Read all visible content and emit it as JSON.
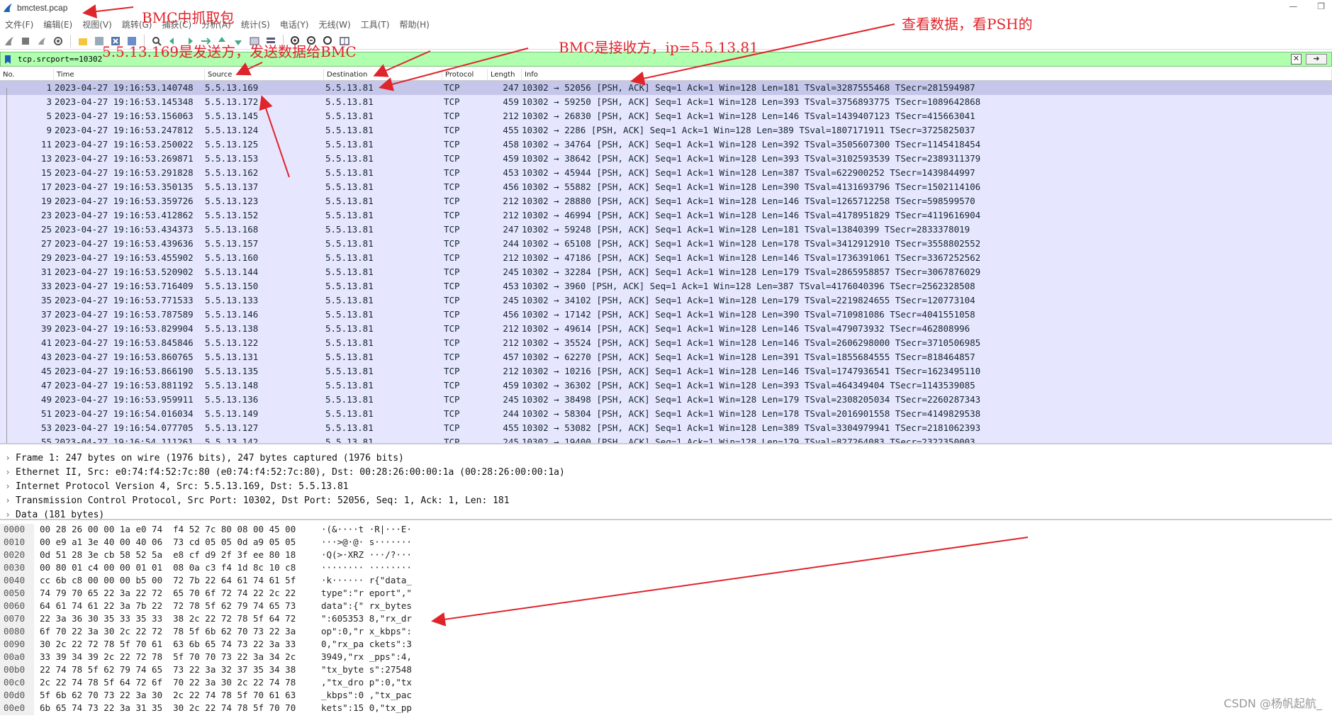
{
  "window": {
    "title": "bmctest.pcap",
    "minimize": "—",
    "restore": "❐"
  },
  "menu": [
    "文件(F)",
    "编辑(E)",
    "视图(V)",
    "跳转(G)",
    "捕获(C)",
    "分析(A)",
    "统计(S)",
    "电话(Y)",
    "无线(W)",
    "工具(T)",
    "帮助(H)"
  ],
  "filter": {
    "value": "tcp.srcport==10302",
    "clear": "✕",
    "apply": "➜"
  },
  "columns": [
    "No.",
    "Time",
    "Source",
    "Destination",
    "Protocol",
    "Length",
    "Info"
  ],
  "packets": [
    {
      "no": "1",
      "time": "2023-04-27 19:16:53.140748",
      "src": "5.5.13.169",
      "dst": "5.5.13.81",
      "proto": "TCP",
      "len": "247",
      "info": "10302 → 52056 [PSH, ACK] Seq=1 Ack=1 Win=128 Len=181 TSval=3287555468 TSecr=281594987"
    },
    {
      "no": "3",
      "time": "2023-04-27 19:16:53.145348",
      "src": "5.5.13.172",
      "dst": "5.5.13.81",
      "proto": "TCP",
      "len": "459",
      "info": "10302 → 59250 [PSH, ACK] Seq=1 Ack=1 Win=128 Len=393 TSval=3756893775 TSecr=1089642868"
    },
    {
      "no": "5",
      "time": "2023-04-27 19:16:53.156063",
      "src": "5.5.13.145",
      "dst": "5.5.13.81",
      "proto": "TCP",
      "len": "212",
      "info": "10302 → 26830 [PSH, ACK] Seq=1 Ack=1 Win=128 Len=146 TSval=1439407123 TSecr=415663041"
    },
    {
      "no": "9",
      "time": "2023-04-27 19:16:53.247812",
      "src": "5.5.13.124",
      "dst": "5.5.13.81",
      "proto": "TCP",
      "len": "455",
      "info": "10302 → 2286 [PSH, ACK] Seq=1 Ack=1 Win=128 Len=389 TSval=1807171911 TSecr=3725825037"
    },
    {
      "no": "11",
      "time": "2023-04-27 19:16:53.250022",
      "src": "5.5.13.125",
      "dst": "5.5.13.81",
      "proto": "TCP",
      "len": "458",
      "info": "10302 → 34764 [PSH, ACK] Seq=1 Ack=1 Win=128 Len=392 TSval=3505607300 TSecr=1145418454"
    },
    {
      "no": "13",
      "time": "2023-04-27 19:16:53.269871",
      "src": "5.5.13.153",
      "dst": "5.5.13.81",
      "proto": "TCP",
      "len": "459",
      "info": "10302 → 38642 [PSH, ACK] Seq=1 Ack=1 Win=128 Len=393 TSval=3102593539 TSecr=2389311379"
    },
    {
      "no": "15",
      "time": "2023-04-27 19:16:53.291828",
      "src": "5.5.13.162",
      "dst": "5.5.13.81",
      "proto": "TCP",
      "len": "453",
      "info": "10302 → 45944 [PSH, ACK] Seq=1 Ack=1 Win=128 Len=387 TSval=622900252 TSecr=1439844997"
    },
    {
      "no": "17",
      "time": "2023-04-27 19:16:53.350135",
      "src": "5.5.13.137",
      "dst": "5.5.13.81",
      "proto": "TCP",
      "len": "456",
      "info": "10302 → 55882 [PSH, ACK] Seq=1 Ack=1 Win=128 Len=390 TSval=4131693796 TSecr=1502114106"
    },
    {
      "no": "19",
      "time": "2023-04-27 19:16:53.359726",
      "src": "5.5.13.123",
      "dst": "5.5.13.81",
      "proto": "TCP",
      "len": "212",
      "info": "10302 → 28880 [PSH, ACK] Seq=1 Ack=1 Win=128 Len=146 TSval=1265712258 TSecr=598599570"
    },
    {
      "no": "23",
      "time": "2023-04-27 19:16:53.412862",
      "src": "5.5.13.152",
      "dst": "5.5.13.81",
      "proto": "TCP",
      "len": "212",
      "info": "10302 → 46994 [PSH, ACK] Seq=1 Ack=1 Win=128 Len=146 TSval=4178951829 TSecr=4119616904"
    },
    {
      "no": "25",
      "time": "2023-04-27 19:16:53.434373",
      "src": "5.5.13.168",
      "dst": "5.5.13.81",
      "proto": "TCP",
      "len": "247",
      "info": "10302 → 59248 [PSH, ACK] Seq=1 Ack=1 Win=128 Len=181 TSval=13840399 TSecr=2833378019"
    },
    {
      "no": "27",
      "time": "2023-04-27 19:16:53.439636",
      "src": "5.5.13.157",
      "dst": "5.5.13.81",
      "proto": "TCP",
      "len": "244",
      "info": "10302 → 65108 [PSH, ACK] Seq=1 Ack=1 Win=128 Len=178 TSval=3412912910 TSecr=3558802552"
    },
    {
      "no": "29",
      "time": "2023-04-27 19:16:53.455902",
      "src": "5.5.13.160",
      "dst": "5.5.13.81",
      "proto": "TCP",
      "len": "212",
      "info": "10302 → 47186 [PSH, ACK] Seq=1 Ack=1 Win=128 Len=146 TSval=1736391061 TSecr=3367252562"
    },
    {
      "no": "31",
      "time": "2023-04-27 19:16:53.520902",
      "src": "5.5.13.144",
      "dst": "5.5.13.81",
      "proto": "TCP",
      "len": "245",
      "info": "10302 → 32284 [PSH, ACK] Seq=1 Ack=1 Win=128 Len=179 TSval=2865958857 TSecr=3067876029"
    },
    {
      "no": "33",
      "time": "2023-04-27 19:16:53.716409",
      "src": "5.5.13.150",
      "dst": "5.5.13.81",
      "proto": "TCP",
      "len": "453",
      "info": "10302 → 3960 [PSH, ACK] Seq=1 Ack=1 Win=128 Len=387 TSval=4176040396 TSecr=2562328508"
    },
    {
      "no": "35",
      "time": "2023-04-27 19:16:53.771533",
      "src": "5.5.13.133",
      "dst": "5.5.13.81",
      "proto": "TCP",
      "len": "245",
      "info": "10302 → 34102 [PSH, ACK] Seq=1 Ack=1 Win=128 Len=179 TSval=2219824655 TSecr=120773104"
    },
    {
      "no": "37",
      "time": "2023-04-27 19:16:53.787589",
      "src": "5.5.13.146",
      "dst": "5.5.13.81",
      "proto": "TCP",
      "len": "456",
      "info": "10302 → 17142 [PSH, ACK] Seq=1 Ack=1 Win=128 Len=390 TSval=710981086 TSecr=4041551058"
    },
    {
      "no": "39",
      "time": "2023-04-27 19:16:53.829904",
      "src": "5.5.13.138",
      "dst": "5.5.13.81",
      "proto": "TCP",
      "len": "212",
      "info": "10302 → 49614 [PSH, ACK] Seq=1 Ack=1 Win=128 Len=146 TSval=479073932 TSecr=462808996"
    },
    {
      "no": "41",
      "time": "2023-04-27 19:16:53.845846",
      "src": "5.5.13.122",
      "dst": "5.5.13.81",
      "proto": "TCP",
      "len": "212",
      "info": "10302 → 35524 [PSH, ACK] Seq=1 Ack=1 Win=128 Len=146 TSval=2606298000 TSecr=3710506985"
    },
    {
      "no": "43",
      "time": "2023-04-27 19:16:53.860765",
      "src": "5.5.13.131",
      "dst": "5.5.13.81",
      "proto": "TCP",
      "len": "457",
      "info": "10302 → 62270 [PSH, ACK] Seq=1 Ack=1 Win=128 Len=391 TSval=1855684555 TSecr=818464857"
    },
    {
      "no": "45",
      "time": "2023-04-27 19:16:53.866190",
      "src": "5.5.13.135",
      "dst": "5.5.13.81",
      "proto": "TCP",
      "len": "212",
      "info": "10302 → 10216 [PSH, ACK] Seq=1 Ack=1 Win=128 Len=146 TSval=1747936541 TSecr=1623495110"
    },
    {
      "no": "47",
      "time": "2023-04-27 19:16:53.881192",
      "src": "5.5.13.148",
      "dst": "5.5.13.81",
      "proto": "TCP",
      "len": "459",
      "info": "10302 → 36302 [PSH, ACK] Seq=1 Ack=1 Win=128 Len=393 TSval=464349404 TSecr=1143539085"
    },
    {
      "no": "49",
      "time": "2023-04-27 19:16:53.959911",
      "src": "5.5.13.136",
      "dst": "5.5.13.81",
      "proto": "TCP",
      "len": "245",
      "info": "10302 → 38498 [PSH, ACK] Seq=1 Ack=1 Win=128 Len=179 TSval=2308205034 TSecr=2260287343"
    },
    {
      "no": "51",
      "time": "2023-04-27 19:16:54.016034",
      "src": "5.5.13.149",
      "dst": "5.5.13.81",
      "proto": "TCP",
      "len": "244",
      "info": "10302 → 58304 [PSH, ACK] Seq=1 Ack=1 Win=128 Len=178 TSval=2016901558 TSecr=4149829538"
    },
    {
      "no": "53",
      "time": "2023-04-27 19:16:54.077705",
      "src": "5.5.13.127",
      "dst": "5.5.13.81",
      "proto": "TCP",
      "len": "455",
      "info": "10302 → 53082 [PSH, ACK] Seq=1 Ack=1 Win=128 Len=389 TSval=3304979941 TSecr=2181062393"
    },
    {
      "no": "55",
      "time": "2023-04-27 19:16:54.111261",
      "src": "5.5.13.142",
      "dst": "5.5.13.81",
      "proto": "TCP",
      "len": "245",
      "info": "10302 → 19400 [PSH, ACK] Seq=1 Ack=1 Win=128 Len=179 TSval=827264083 TSecr=2322350003"
    }
  ],
  "details": [
    "Frame 1: 247 bytes on wire (1976 bits), 247 bytes captured (1976 bits)",
    "Ethernet II, Src: e0:74:f4:52:7c:80 (e0:74:f4:52:7c:80), Dst: 00:28:26:00:00:1a (00:28:26:00:00:1a)",
    "Internet Protocol Version 4, Src: 5.5.13.169, Dst: 5.5.13.81",
    "Transmission Control Protocol, Src Port: 10302, Dst Port: 52056, Seq: 1, Ack: 1, Len: 181",
    "Data (181 bytes)"
  ],
  "bytes": [
    {
      "off": "0000",
      "hex": "00 28 26 00 00 1a e0 74  f4 52 7c 80 08 00 45 00",
      "ascii": "·(&····t ·R|···E·"
    },
    {
      "off": "0010",
      "hex": "00 e9 a1 3e 40 00 40 06  73 cd 05 05 0d a9 05 05",
      "ascii": "···>@·@· s·······"
    },
    {
      "off": "0020",
      "hex": "0d 51 28 3e cb 58 52 5a  e8 cf d9 2f 3f ee 80 18",
      "ascii": "·Q(>·XRZ ···/?···"
    },
    {
      "off": "0030",
      "hex": "00 80 01 c4 00 00 01 01  08 0a c3 f4 1d 8c 10 c8",
      "ascii": "········ ········"
    },
    {
      "off": "0040",
      "hex": "cc 6b c8 00 00 00 b5 00  72 7b 22 64 61 74 61 5f",
      "ascii": "·k······ r{\"data_"
    },
    {
      "off": "0050",
      "hex": "74 79 70 65 22 3a 22 72  65 70 6f 72 74 22 2c 22",
      "ascii": "type\":\"r eport\",\""
    },
    {
      "off": "0060",
      "hex": "64 61 74 61 22 3a 7b 22  72 78 5f 62 79 74 65 73",
      "ascii": "data\":{\" rx_bytes"
    },
    {
      "off": "0070",
      "hex": "22 3a 36 30 35 33 35 33  38 2c 22 72 78 5f 64 72",
      "ascii": "\":605353 8,\"rx_dr"
    },
    {
      "off": "0080",
      "hex": "6f 70 22 3a 30 2c 22 72  78 5f 6b 62 70 73 22 3a",
      "ascii": "op\":0,\"r x_kbps\":"
    },
    {
      "off": "0090",
      "hex": "30 2c 22 72 78 5f 70 61  63 6b 65 74 73 22 3a 33",
      "ascii": "0,\"rx_pa ckets\":3"
    },
    {
      "off": "00a0",
      "hex": "33 39 34 39 2c 22 72 78  5f 70 70 73 22 3a 34 2c",
      "ascii": "3949,\"rx _pps\":4,"
    },
    {
      "off": "00b0",
      "hex": "22 74 78 5f 62 79 74 65  73 22 3a 32 37 35 34 38",
      "ascii": "\"tx_byte s\":27548"
    },
    {
      "off": "00c0",
      "hex": "2c 22 74 78 5f 64 72 6f  70 22 3a 30 2c 22 74 78",
      "ascii": ",\"tx_dro p\":0,\"tx"
    },
    {
      "off": "00d0",
      "hex": "5f 6b 62 70 73 22 3a 30  2c 22 74 78 5f 70 61 63",
      "ascii": "_kbps\":0 ,\"tx_pac"
    },
    {
      "off": "00e0",
      "hex": "6b 65 74 73 22 3a 31 35  30 2c 22 74 78 5f 70 70",
      "ascii": "kets\":15 0,\"tx_pp"
    }
  ],
  "annotations": {
    "capture_note": "BMC中抓取包",
    "sender_note": "5.5.13.169是发送方，发送数据给BMC",
    "receiver_note": "BMC是接收方，ip=5.5.13.81",
    "data_note": "查看数据，看PSH的"
  },
  "watermark": "CSDN @杨帆起航_",
  "colors": {
    "annotation": "#e0242b",
    "filter_ok": "#afffaf",
    "row_tcp": "#e7e6ff",
    "row_selected": "#c6c6ea"
  }
}
